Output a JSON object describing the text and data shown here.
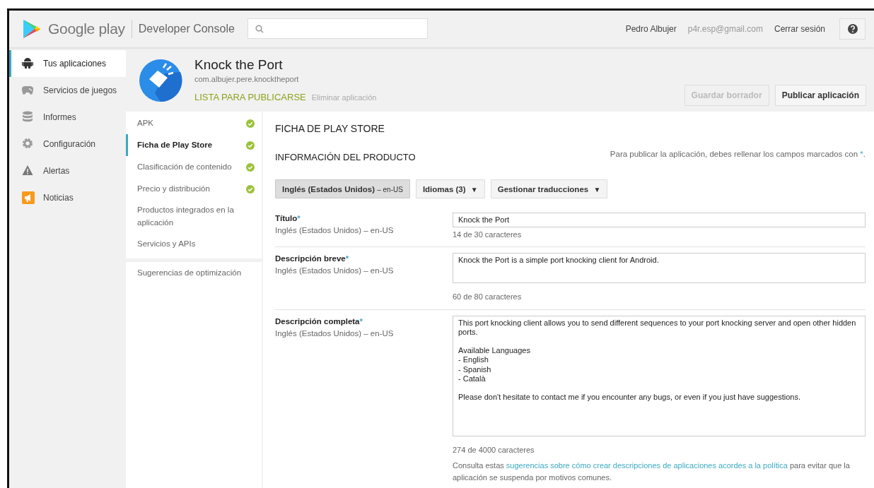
{
  "header": {
    "brand": "Google play",
    "product": "Developer Console",
    "user_name": "Pedro Albujer",
    "user_email": "p4r.esp@gmail.com",
    "logout": "Cerrar sesión"
  },
  "sidebar": {
    "items": [
      {
        "label": "Tus aplicaciones",
        "selected": true
      },
      {
        "label": "Servicios de juegos",
        "selected": false
      },
      {
        "label": "Informes",
        "selected": false
      },
      {
        "label": "Configuración",
        "selected": false
      },
      {
        "label": "Alertas",
        "selected": false
      },
      {
        "label": "Noticias",
        "selected": false
      }
    ]
  },
  "app": {
    "name": "Knock the Port",
    "package": "com.albujer.pere.knocktheport",
    "status": "LISTA PARA PUBLICARSE",
    "delete_link": "Eliminar aplicación",
    "buttons": [
      {
        "label": "Guardar borrador",
        "disabled": true
      },
      {
        "label": "Publicar aplicación",
        "disabled": false
      }
    ]
  },
  "subnav": {
    "groups": [
      {
        "items": [
          {
            "label": "APK",
            "done": true,
            "selected": false
          },
          {
            "label": "Ficha de Play Store",
            "done": true,
            "selected": true
          },
          {
            "label": "Clasificación de contenido",
            "done": true,
            "selected": false
          },
          {
            "label": "Precio y distribución",
            "done": true,
            "selected": false
          },
          {
            "label": "Productos integrados en la aplicación",
            "done": false,
            "selected": false
          },
          {
            "label": "Servicios y APIs",
            "done": false,
            "selected": false
          }
        ]
      },
      {
        "items": [
          {
            "label": "Sugerencias de optimización",
            "done": false,
            "selected": false
          }
        ]
      }
    ]
  },
  "content": {
    "title": "FICHA DE PLAY STORE",
    "section": "INFORMACIÓN DEL PRODUCTO",
    "hint": {
      "before": "Para publicar la aplicación, debes rellenar los campos marcados con ",
      "marker": "*",
      "after": "."
    },
    "language_buttons": [
      {
        "kind": "language",
        "label": "Inglés (Estados Unidos)",
        "code": "– en-US",
        "selected": true
      },
      {
        "kind": "dropdown",
        "label": "Idiomas (3)",
        "caret": "▼",
        "selected": false
      },
      {
        "kind": "dropdown",
        "label": "Gestionar traducciones",
        "caret": "▼",
        "selected": false
      }
    ],
    "fields": [
      {
        "kind": "input",
        "label": "Título",
        "marker": "*",
        "language": "Inglés (Estados Unidos) – en-US",
        "value": "Knock the Port",
        "count": "14 de 30 caracteres"
      },
      {
        "kind": "short",
        "label": "Descripción breve",
        "marker": "*",
        "language": "Inglés (Estados Unidos) – en-US",
        "value": "Knock the Port is a simple port knocking client for Android.",
        "count": "60 de 80 caracteres"
      },
      {
        "kind": "long",
        "label": "Descripción completa",
        "marker": "*",
        "language": "Inglés (Estados Unidos) – en-US",
        "value": "This port knocking client allows you to send different sequences to your port knocking server and open other hidden ports.\n\nAvailable Languages\n- English\n- Spanish\n- Català\n\nPlease don't hesitate to contact me if you encounter any bugs, or even if you just have suggestions.",
        "count": "274 de 4000 caracteres",
        "note": {
          "before": "Consulta estas ",
          "link": "sugerencias sobre cómo crear descripciones de aplicaciones acordes a la política",
          "after": " para evitar que la aplicación se suspenda por motivos comunes."
        }
      }
    ]
  }
}
